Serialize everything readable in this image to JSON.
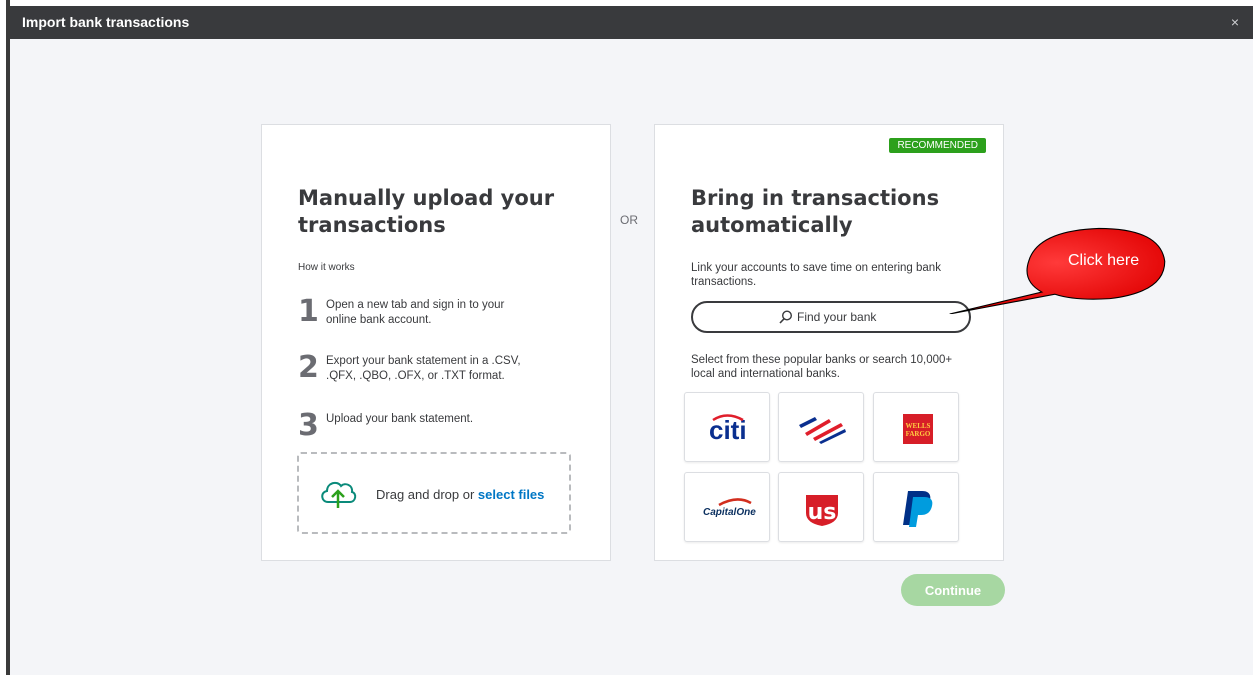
{
  "window": {
    "title": "Import bank transactions",
    "close_symbol": "×"
  },
  "manual": {
    "heading_line1": "Manually upload your",
    "heading_line2": "transactions",
    "how_it_works": "How it works",
    "steps": [
      {
        "num": "1",
        "line1": "Open a new tab and sign in to your",
        "line2": "online bank account."
      },
      {
        "num": "2",
        "line1": "Export your bank statement in a .CSV,",
        "line2": ".QFX, .QBO, .OFX, or .TXT format."
      },
      {
        "num": "3",
        "line1": "Upload your bank statement.",
        "line2": ""
      }
    ],
    "drop_text": "Drag and drop or ",
    "drop_link": "select files"
  },
  "or_label": "OR",
  "auto": {
    "badge": "RECOMMENDED",
    "heading_line1": "Bring in transactions",
    "heading_line2": "automatically",
    "desc_line1": "Link your accounts to save time on entering bank",
    "desc_line2": "transactions.",
    "search_placeholder": "Find your bank",
    "popular_line1": "Select from these popular banks or search 10,000+",
    "popular_line2": "local and international banks.",
    "banks": [
      {
        "name": "citi",
        "logo_text": "citi"
      },
      {
        "name": "bank-of-america",
        "logo_text": ""
      },
      {
        "name": "wells-fargo",
        "logo_text_1": "WELLS",
        "logo_text_2": "FARGO"
      },
      {
        "name": "capital-one",
        "logo_text": "CapitalOne"
      },
      {
        "name": "us-bank",
        "logo_text": "us"
      },
      {
        "name": "paypal",
        "logo_text": ""
      }
    ]
  },
  "continue_label": "Continue",
  "callout_text": "Click here",
  "colors": {
    "brand_green": "#2ca01c",
    "continue_disabled": "#a7d7a2",
    "link_blue": "#0077c5",
    "callout_red": "#ff0000",
    "titlebar": "#393a3d"
  }
}
